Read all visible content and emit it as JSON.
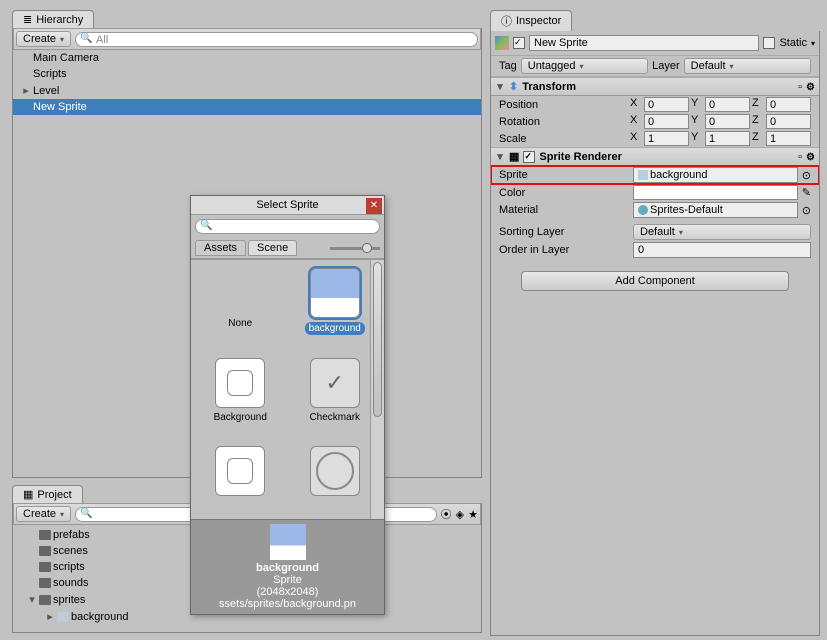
{
  "hierarchy": {
    "tab": "Hierarchy",
    "create": "Create",
    "search_prefix": "All",
    "items": [
      "Main Camera",
      "Scripts",
      "Level",
      "New Sprite"
    ]
  },
  "project": {
    "tab": "Project",
    "create": "Create",
    "folders": [
      "prefabs",
      "scenes",
      "scripts",
      "sounds",
      "sprites"
    ],
    "sprite_child": "background"
  },
  "inspector": {
    "tab": "Inspector",
    "object_name": "New Sprite",
    "static_label": "Static",
    "tag_label": "Tag",
    "tag_value": "Untagged",
    "layer_label": "Layer",
    "layer_value": "Default",
    "transform": {
      "title": "Transform",
      "position_label": "Position",
      "rotation_label": "Rotation",
      "scale_label": "Scale",
      "position": {
        "x": "0",
        "y": "0",
        "z": "0"
      },
      "rotation": {
        "x": "0",
        "y": "0",
        "z": "0"
      },
      "scale": {
        "x": "1",
        "y": "1",
        "z": "1"
      }
    },
    "sprite_renderer": {
      "title": "Sprite Renderer",
      "sprite_label": "Sprite",
      "sprite_value": "background",
      "color_label": "Color",
      "material_label": "Material",
      "material_value": "Sprites-Default",
      "sorting_layer_label": "Sorting Layer",
      "sorting_layer_value": "Default",
      "order_label": "Order in Layer",
      "order_value": "0"
    },
    "add_component": "Add Component"
  },
  "modal": {
    "title": "Select Sprite",
    "tab_assets": "Assets",
    "tab_scene": "Scene",
    "items": {
      "none": "None",
      "background": "background",
      "Background": "Background",
      "Checkmark": "Checkmark"
    },
    "footer": {
      "name": "background",
      "type": "Sprite",
      "dims": "(2048x2048)",
      "path": "ssets/sprites/background.pn"
    }
  }
}
